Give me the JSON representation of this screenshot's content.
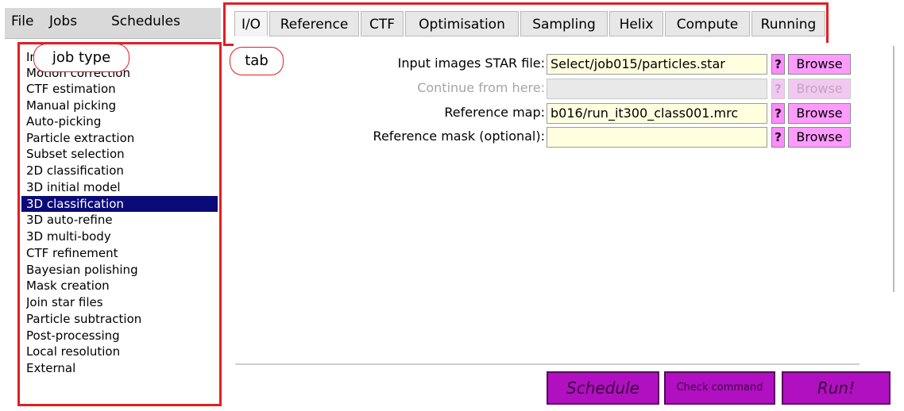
{
  "menu": {
    "file": "File",
    "jobs": "Jobs",
    "schedules": "Schedules"
  },
  "job_types": {
    "items": [
      "Import",
      "Motion correction",
      "CTF estimation",
      "Manual picking",
      "Auto-picking",
      "Particle extraction",
      "Subset selection",
      "2D classification",
      "3D initial model",
      "3D classification",
      "3D auto-refine",
      "3D multi-body",
      "CTF refinement",
      "Bayesian polishing",
      "Mask creation",
      "Join star files",
      "Particle subtraction",
      "Post-processing",
      "Local resolution",
      "External"
    ],
    "selected": "3D classification"
  },
  "tabs": [
    "I/O",
    "Reference",
    "CTF",
    "Optimisation",
    "Sampling",
    "Helix",
    "Compute",
    "Running"
  ],
  "active_tab": "I/O",
  "io_fields": [
    {
      "label": "Input images STAR file:",
      "value": "Select/job015/particles.star",
      "enabled": true,
      "help": "?",
      "browse": "Browse"
    },
    {
      "label": "Continue from here:",
      "value": "",
      "enabled": false,
      "help": "?",
      "browse": "Browse"
    },
    {
      "label": "Reference map:",
      "value": "b016/run_it300_class001.mrc",
      "enabled": true,
      "help": "?",
      "browse": "Browse"
    },
    {
      "label": "Reference mask (optional):",
      "value": "",
      "enabled": true,
      "help": "?",
      "browse": "Browse"
    }
  ],
  "actions": {
    "schedule": "Schedule",
    "check_command": "Check command",
    "run": "Run!"
  },
  "annotations": {
    "job_type": "job type",
    "tab": "tab"
  },
  "colors": {
    "selection": "#0a0a78",
    "field_bg": "#ffffe0",
    "help_button": "#ff8cff",
    "action_button": "#b010c0",
    "annotation": "#e01f22"
  }
}
